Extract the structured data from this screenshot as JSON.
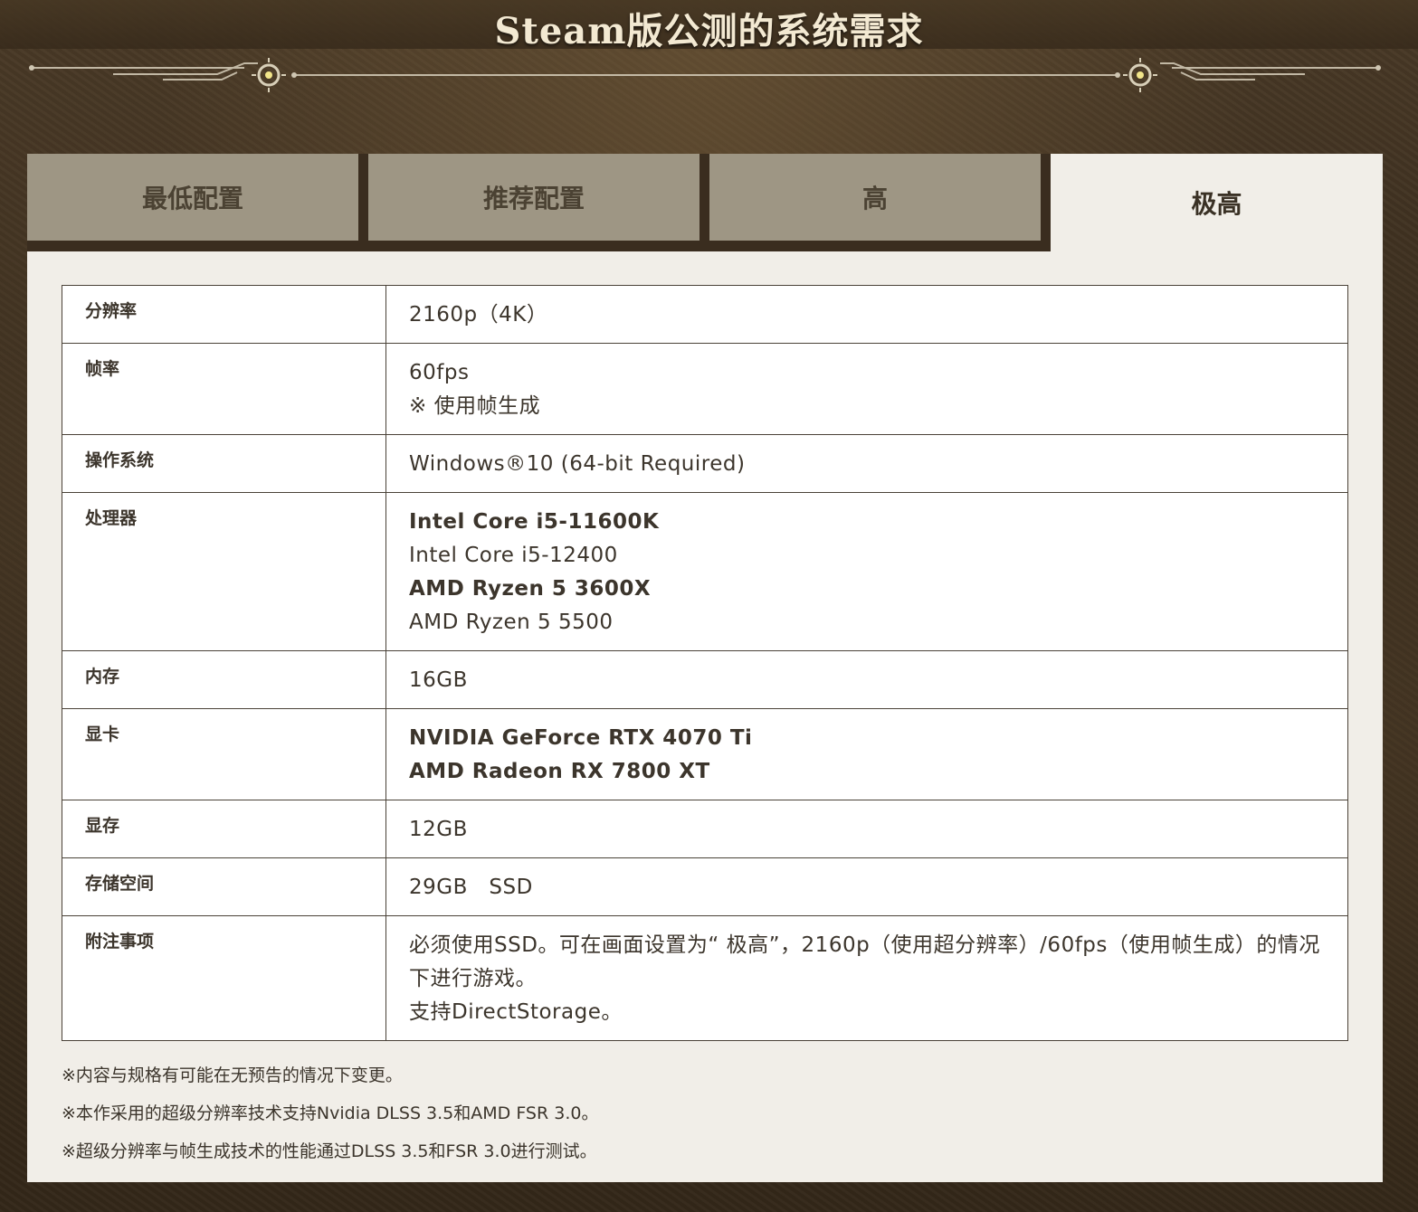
{
  "header": {
    "title": "Steam版公测的系统需求"
  },
  "tabs": [
    {
      "label": "最低配置",
      "active": false
    },
    {
      "label": "推荐配置",
      "active": false
    },
    {
      "label": "高",
      "active": false
    },
    {
      "label": "极高",
      "active": true
    }
  ],
  "specs": {
    "resolution": {
      "label": "分辨率",
      "lines": [
        "2160p（4K）"
      ]
    },
    "framerate": {
      "label": "帧率",
      "lines": [
        "60fps",
        "※ 使用帧生成"
      ]
    },
    "os": {
      "label": "操作系统",
      "lines": [
        "Windows®10 (64-bit Required)"
      ]
    },
    "cpu": {
      "label": "处理器",
      "lines": [
        "Intel Core i5-11600K",
        "Intel Core i5-12400",
        "AMD Ryzen 5 3600X",
        "AMD Ryzen 5 5500"
      ]
    },
    "memory": {
      "label": "内存",
      "lines": [
        "16GB"
      ]
    },
    "gpu": {
      "label": "显卡",
      "lines": [
        "NVIDIA GeForce RTX 4070 Ti",
        "AMD Radeon RX 7800 XT"
      ]
    },
    "vram": {
      "label": "显存",
      "lines": [
        "12GB"
      ]
    },
    "storage": {
      "label": "存储空间",
      "lines": [
        "29GB　SSD"
      ]
    },
    "notes": {
      "label": "附注事项",
      "lines": [
        "必须使用SSD。可在画面设置为“ 极高”，2160p（使用超分辨率）/60fps（使用帧生成）的情况下进行游戏。",
        "支持DirectStorage。"
      ]
    }
  },
  "footnotes": [
    "※内容与规格有可能在无预告的情况下变更。",
    "※本作采用的超级分辨率技术支持Nvidia DLSS 3.5和AMD FSR 3.0。",
    "※超级分辨率与帧生成技术的性能通过DLSS 3.5和FSR 3.0进行测试。"
  ],
  "colors": {
    "background": "#3b2e1f",
    "tab_inactive": "#9e9684",
    "tab_active": "#f1eee8",
    "title": "#f3e9d2",
    "text": "#3c352c"
  }
}
